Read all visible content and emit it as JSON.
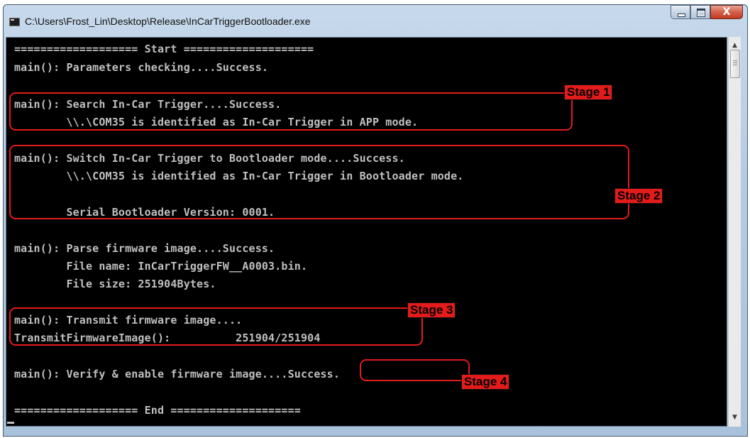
{
  "window": {
    "title": "C:\\Users\\Frost_Lin\\Desktop\\Release\\InCarTriggerBootloader.exe",
    "close_glyph": "X"
  },
  "console": {
    "lines": [
      "=================== Start ====================",
      "main(): Parameters checking....Success.",
      "",
      "main(): Search In-Car Trigger....Success.",
      "        \\\\.\\COM35 is identified as In-Car Trigger in APP mode.",
      "",
      "main(): Switch In-Car Trigger to Bootloader mode....Success.",
      "        \\\\.\\COM35 is identified as In-Car Trigger in Bootloader mode.",
      "",
      "        Serial Bootloader Version: 0001.",
      "",
      "main(): Parse firmware image....Success.",
      "        File name: InCarTriggerFW__A0003.bin.",
      "        File size: 251904Bytes.",
      "",
      "main(): Transmit firmware image....",
      "TransmitFirmwareImage():          251904/251904",
      "",
      "main(): Verify & enable firmware image....Success.",
      "",
      "=================== End ===================="
    ]
  },
  "annotations": {
    "stage1": "Stage 1",
    "stage2": "Stage 2",
    "stage3": "Stage 3",
    "stage4": "Stage 4",
    "color": "#e41b1b"
  },
  "icons": {
    "scroll_up": "scroll-up-arrow-icon",
    "scroll_down": "scroll-down-arrow-icon"
  }
}
